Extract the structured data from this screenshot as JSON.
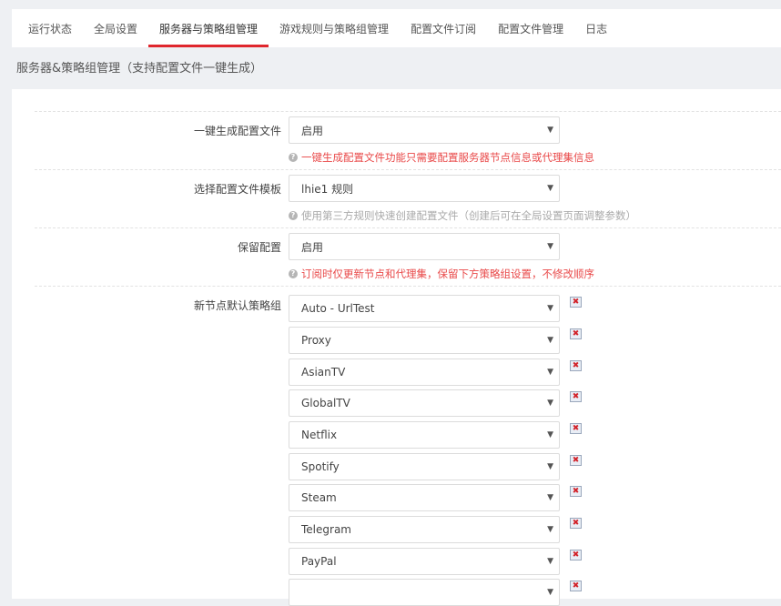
{
  "tabs": [
    {
      "label": "运行状态"
    },
    {
      "label": "全局设置"
    },
    {
      "label": "服务器与策略组管理"
    },
    {
      "label": "游戏规则与策略组管理"
    },
    {
      "label": "配置文件订阅"
    },
    {
      "label": "配置文件管理"
    },
    {
      "label": "日志"
    }
  ],
  "active_tab_index": 2,
  "section_title": "服务器&策略组管理（支持配置文件一键生成）",
  "form": {
    "auto_generate": {
      "label": "一键生成配置文件",
      "value": "启用",
      "hint": "一键生成配置文件功能只需要配置服务器节点信息或代理集信息"
    },
    "template": {
      "label": "选择配置文件模板",
      "value": "lhie1 规则",
      "hint": "使用第三方规则快速创建配置文件（创建后可在全局设置页面调整参数）"
    },
    "keep_config": {
      "label": "保留配置",
      "value": "启用",
      "hint": "订阅时仅更新节点和代理集，保留下方策略组设置，不修改顺序"
    },
    "default_groups": {
      "label": "新节点默认策略组",
      "items": [
        "Auto - UrlTest",
        "Proxy",
        "AsianTV",
        "GlobalTV",
        "Netflix",
        "Spotify",
        "Steam",
        "Telegram",
        "PayPal",
        ""
      ]
    }
  },
  "icons": {
    "hint": "question-circle-icon",
    "delete": "delete-icon"
  },
  "colors": {
    "accent": "#e0262d",
    "warning_text": "#e94a4a",
    "note_text": "#aaaaaa"
  }
}
